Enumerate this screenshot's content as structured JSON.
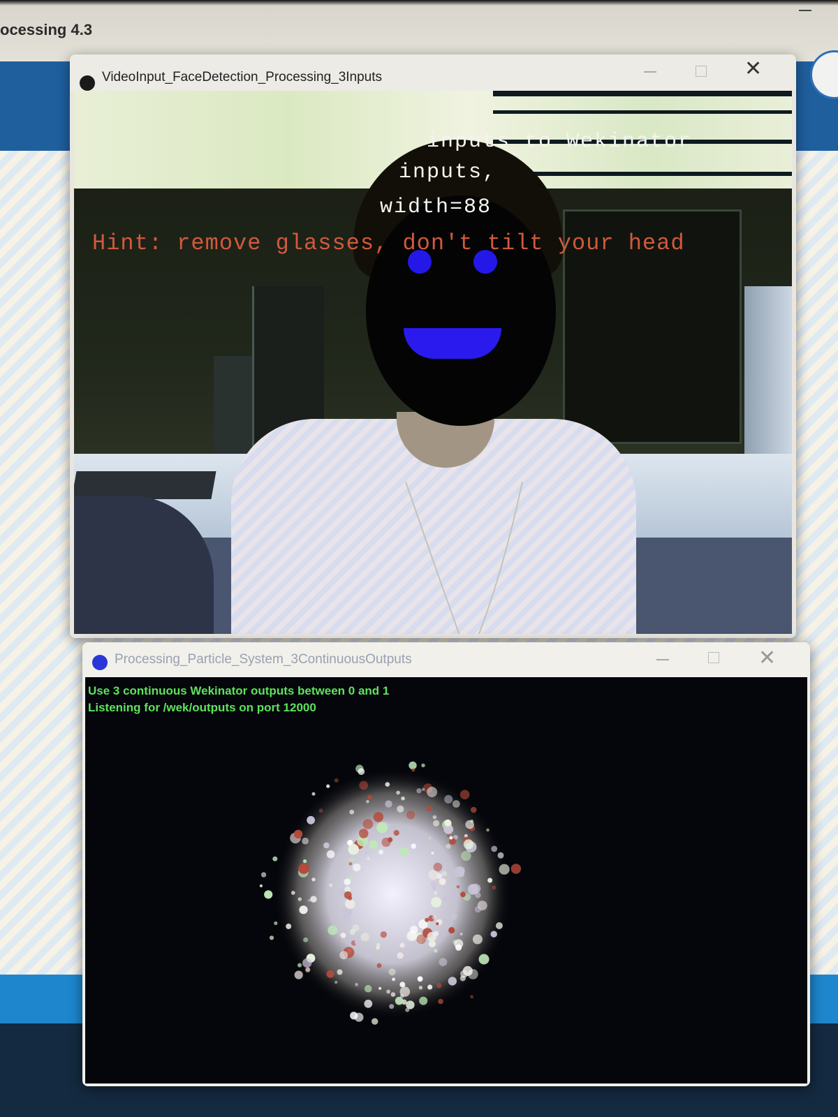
{
  "ide": {
    "title": "ocessing 4.3"
  },
  "face_window": {
    "title": "VideoInput_FaceDetection_Processing_3Inputs",
    "overlay": {
      "line1": "inputs to Wekinator",
      "line2": "inputs,",
      "line3": "width=88",
      "hint": "Hint: remove glasses, don't tilt your head"
    },
    "colors": {
      "hint": "#d05a3c",
      "face_marker": "#2418e8"
    }
  },
  "particle_window": {
    "title": "Processing_Particle_System_3ContinuousOutputs",
    "status_line1": "Use 3 continuous Wekinator outputs between 0 and 1",
    "status_line2": "Listening for /wek/outputs on port 12000",
    "colors": {
      "status": "#5ee35a",
      "background": "#05060b"
    }
  },
  "icons": [
    "app-icon",
    "minimize-icon",
    "maximize-icon",
    "close-icon"
  ]
}
